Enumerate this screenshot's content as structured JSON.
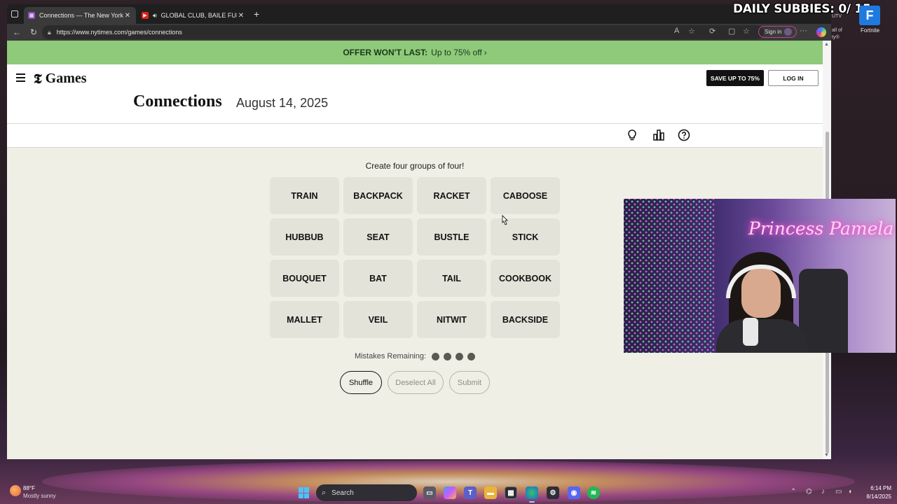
{
  "browser": {
    "tabs": [
      {
        "title": "Connections — The New York Tim",
        "active": true
      },
      {
        "title": "GLOBAL CLUB, BAILE FUNK, ...",
        "active": false
      }
    ],
    "url": "https://www.nytimes.com/games/connections",
    "signin_label": "Sign in"
  },
  "promo": {
    "bold": "OFFER WON'T LAST:",
    "rest": "Up to 75% off",
    "chevron": "›"
  },
  "header": {
    "logo_mark": "𝕿",
    "logo_text": "Games",
    "save_label": "SAVE UP TO 75%",
    "login_label": "LOG IN"
  },
  "game": {
    "title": "Connections",
    "date": "August 14, 2025",
    "instruction": "Create four groups of four!",
    "words": [
      "TRAIN",
      "BACKPACK",
      "RACKET",
      "CABOOSE",
      "HUBBUB",
      "SEAT",
      "BUSTLE",
      "STICK",
      "BOUQUET",
      "BAT",
      "TAIL",
      "COOKBOOK",
      "MALLET",
      "VEIL",
      "NITWIT",
      "BACKSIDE"
    ],
    "mistakes_label": "Mistakes Remaining:",
    "mistakes_remaining": 4,
    "buttons": {
      "shuffle": "Shuffle",
      "deselect": "Deselect All",
      "submit": "Submit"
    }
  },
  "overlay": {
    "subbies": "DAILY SUBBIES: 0/ 15",
    "fn_letter": "F",
    "fn_label": "Fortnite",
    "side_top": "UTV",
    "side_mid": "all of",
    "side_bot": "ty®",
    "webcam_neon": "Princess Pamela"
  },
  "taskbar": {
    "temp": "88°F",
    "weather": "Mostly sunny",
    "search_placeholder": "Search",
    "time": "6:14 PM",
    "date": "8/14/2025"
  },
  "colors": {
    "promo_bg": "#8fc97a",
    "page_bg": "#efefe6",
    "tile_bg": "#e3e3d9",
    "dot": "#5a5a52"
  }
}
